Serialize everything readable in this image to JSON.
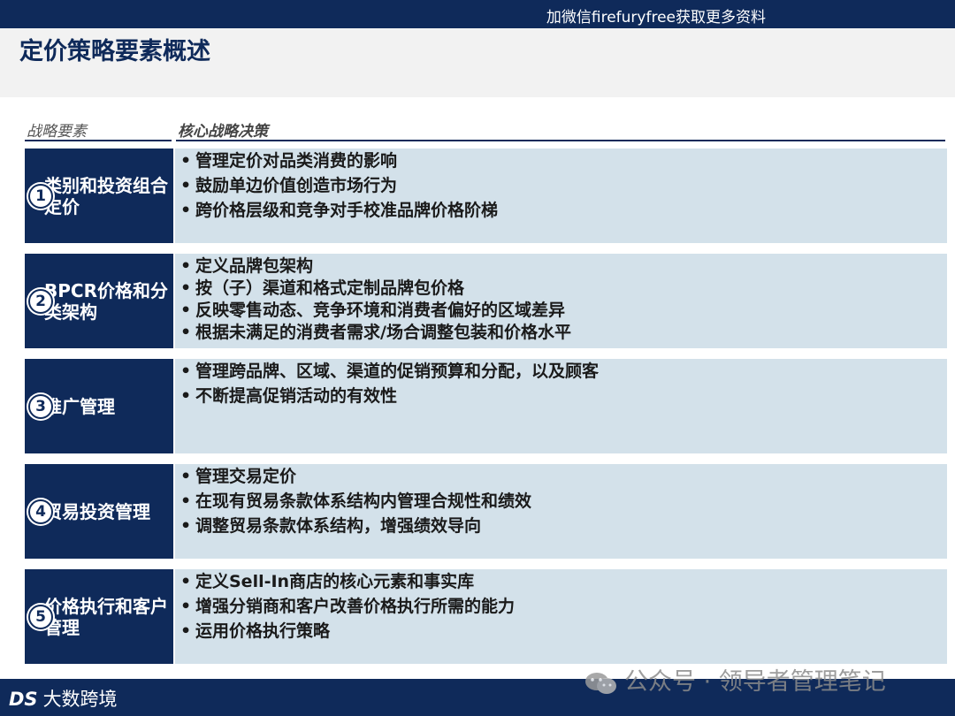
{
  "topbar": {
    "text": "加微信firefuryfree获取更多资料"
  },
  "title": "定价策略要素概述",
  "columns": {
    "left": "战略要素",
    "right": "核心战略决策"
  },
  "rows": [
    {
      "num": "1",
      "label": "类别和投资组合定价",
      "bullets": [
        "管理定价对品类消费的影响",
        "鼓励单边价值创造市场行为",
        "跨价格层级和竞争对手校准品牌价格阶梯"
      ]
    },
    {
      "num": "2",
      "label": "BPCR价格和分类架构",
      "bullets": [
        "定义品牌包架构",
        "按（子）渠道和格式定制品牌包价格",
        "反映零售动态、竞争环境和消费者偏好的区域差异",
        "根据未满足的消费者需求/场合调整包装和价格水平"
      ]
    },
    {
      "num": "3",
      "label": "推广管理",
      "bullets": [
        "管理跨品牌、区域、渠道的促销预算和分配，以及顾客",
        "不断提高促销活动的有效性"
      ]
    },
    {
      "num": "4",
      "label": "贸易投资管理",
      "bullets": [
        "管理交易定价",
        "在现有贸易条款体系结构内管理合规性和绩效",
        "调整贸易条款体系结构，增强绩效导向"
      ]
    },
    {
      "num": "5",
      "label": "价格执行和客户管理",
      "bullets": [
        "定义Sell-In商店的核心元素和事实库",
        "增强分销商和客户改善价格执行所需的能力",
        "运用价格执行策略"
      ]
    }
  ],
  "footer": {
    "brand_logo": "DS",
    "brand_text": "大数跨境",
    "watermark": "公众号 · 领导者管理笔记"
  },
  "colors": {
    "navy": "#0f2a5a",
    "light_blue": "#d3e1ea"
  }
}
